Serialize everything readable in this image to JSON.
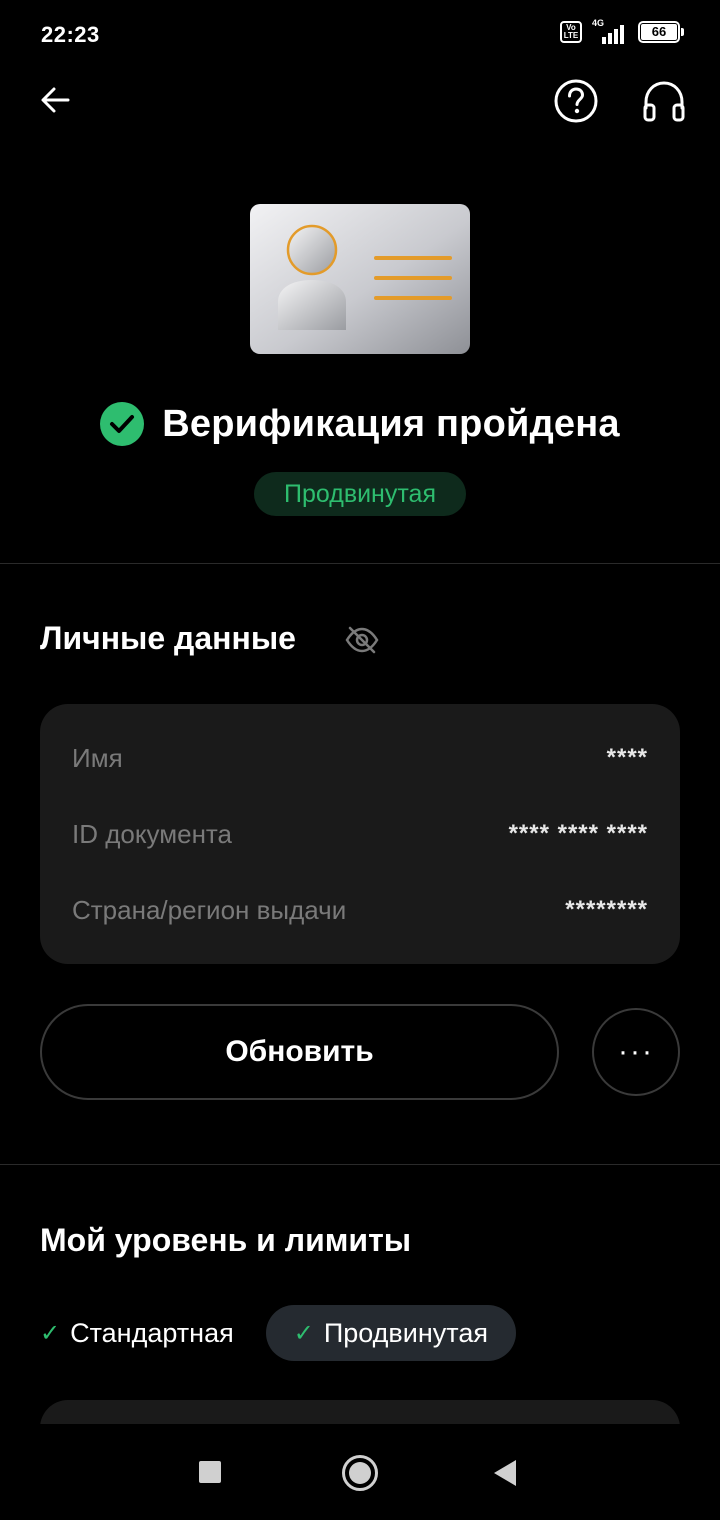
{
  "status_bar": {
    "time": "22:23",
    "volte": "Vo LTE",
    "network": "4G",
    "battery": "66"
  },
  "header": {
    "back_icon": "arrow-left-icon",
    "help_icon": "question-circle-icon",
    "support_icon": "headset-icon"
  },
  "verification": {
    "illustration": "id-card-icon",
    "status_icon": "check-circle-icon",
    "title": "Верификация пройдена",
    "level": "Продвинутая"
  },
  "personal_data": {
    "title": "Личные данные",
    "visibility_icon": "eye-off-icon",
    "rows": [
      {
        "label": "Имя",
        "value": "****"
      },
      {
        "label": "ID документа",
        "value": "**** **** ****"
      },
      {
        "label": "Страна/регион выдачи",
        "value": "********"
      }
    ],
    "update_label": "Обновить",
    "more_label": "···"
  },
  "limits": {
    "title": "Мой уровень и лимиты",
    "levels": [
      {
        "label": "Стандартная",
        "selected": false
      },
      {
        "label": "Продвинутая",
        "selected": true
      }
    ]
  },
  "colors": {
    "accent_green": "#2ebd6f",
    "background": "#000000",
    "card": "#1a1a1a"
  }
}
